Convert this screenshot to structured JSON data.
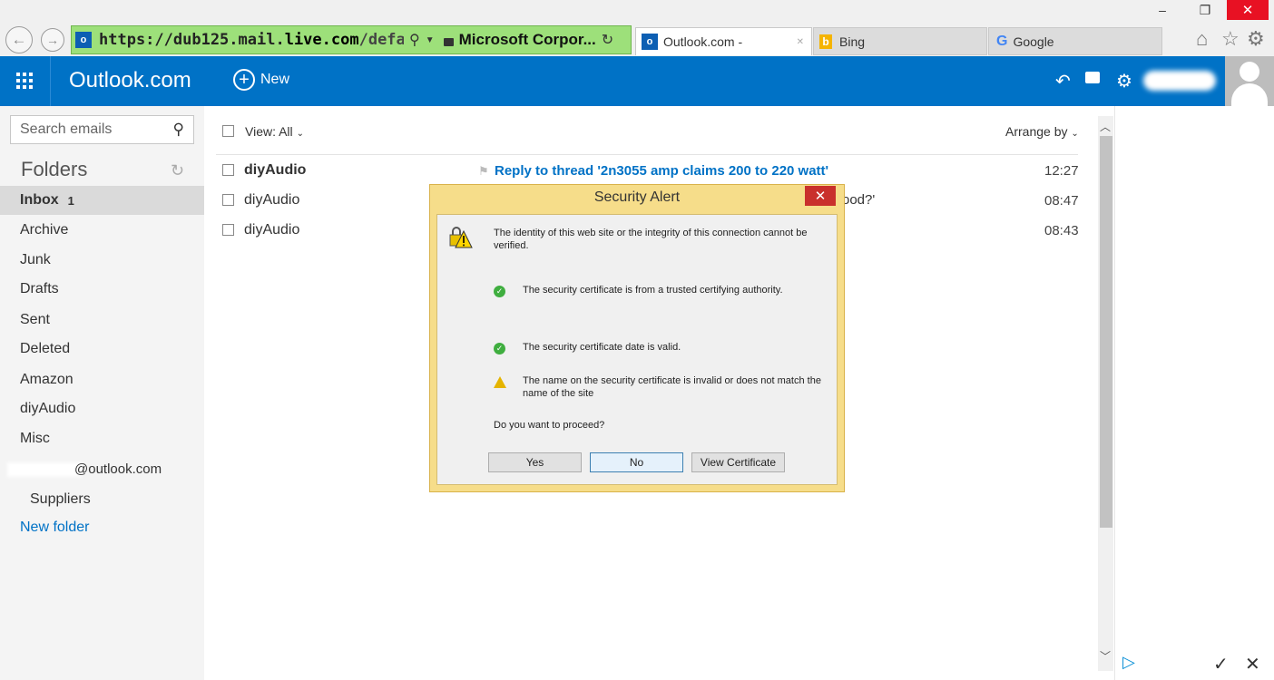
{
  "browser": {
    "url_main": "https://dub125.mail.",
    "url_domain": "live.com",
    "url_path": "/default.asp",
    "site_owner": "Microsoft Corpor...",
    "window_controls": {
      "minimize": "–",
      "maximize": "❐",
      "close": "✕"
    },
    "tabs": [
      {
        "label": "Outlook.com -",
        "icon": "outlook-icon"
      },
      {
        "label": "Bing",
        "icon": "bing-icon"
      },
      {
        "label": "Google",
        "icon": "google-icon"
      }
    ]
  },
  "header": {
    "brand": "Outlook.com",
    "new_label": "New"
  },
  "sidebar": {
    "search_placeholder": "Search emails",
    "folders_title": "Folders",
    "folders": [
      {
        "label": "Inbox",
        "count": "1"
      },
      {
        "label": "Archive"
      },
      {
        "label": "Junk"
      },
      {
        "label": "Drafts"
      },
      {
        "label": "Sent"
      },
      {
        "label": "Deleted"
      },
      {
        "label": "Amazon"
      },
      {
        "label": "diyAudio"
      },
      {
        "label": "Misc"
      }
    ],
    "account": "@outlook.com",
    "subfolder": "Suppliers",
    "new_folder": "New folder"
  },
  "list": {
    "view_label": "View: All",
    "arrange_label": "Arrange by",
    "messages": [
      {
        "sender": "diyAudio",
        "subject": "Reply to thread '2n3055 amp claims 200 to 220 watt'",
        "time": "12:27",
        "unread": true
      },
      {
        "sender": "diyAudio",
        "subject": "ood?'",
        "time": "08:47",
        "unread": false
      },
      {
        "sender": "diyAudio",
        "subject": "",
        "time": "08:43",
        "unread": false
      }
    ]
  },
  "dialog": {
    "title": "Security Alert",
    "intro": "The identity of this web site or the integrity of this connection cannot be verified.",
    "items": [
      {
        "status": "ok",
        "text": "The security certificate is from a trusted certifying authority."
      },
      {
        "status": "ok",
        "text": "The security certificate date is valid."
      },
      {
        "status": "warning",
        "text": "The name on the security certificate is invalid or does not match the name of the site"
      }
    ],
    "question": "Do you want to proceed?",
    "buttons": {
      "yes": "Yes",
      "no": "No",
      "view_cert": "View Certificate"
    }
  },
  "colors": {
    "brand_blue": "#0072c6",
    "address_bar": "#9de07a",
    "dialog_frame": "#f6dd8a"
  }
}
